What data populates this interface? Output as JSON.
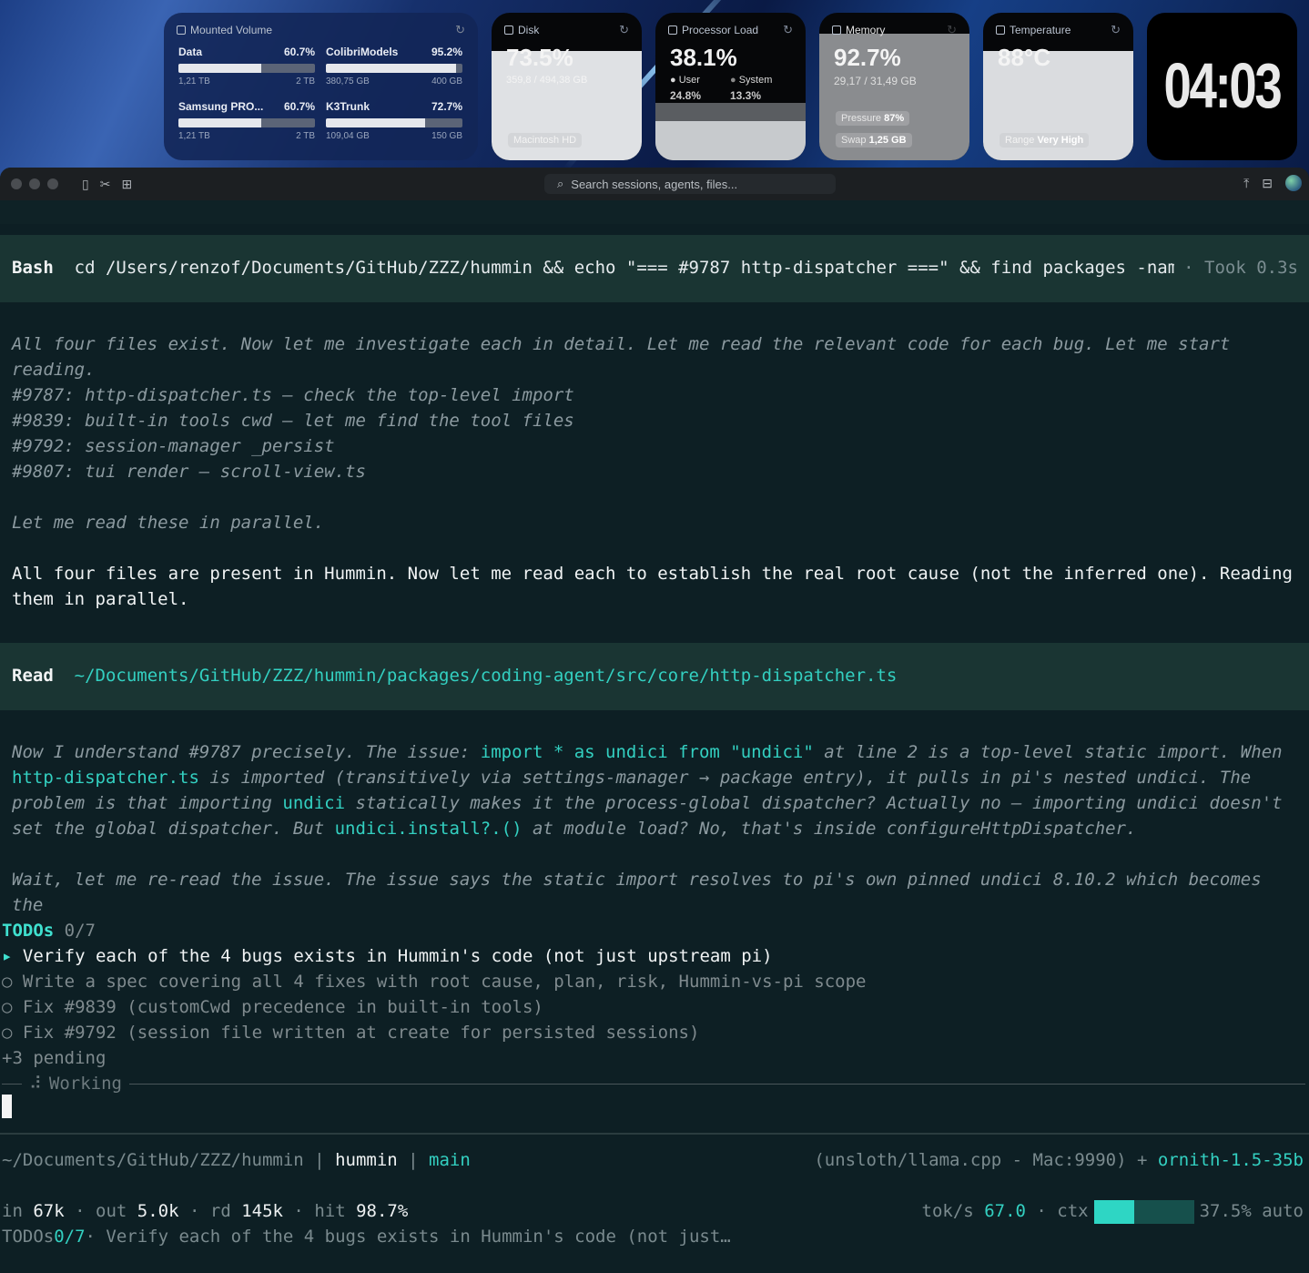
{
  "desktop": {
    "volumes": {
      "title": "Mounted Volume",
      "items": [
        {
          "name": "Data",
          "percent": "60.7%",
          "fill": 0.607,
          "used": "1,21 TB",
          "total": "2 TB"
        },
        {
          "name": "ColibriModels",
          "percent": "95.2%",
          "fill": 0.952,
          "used": "380,75 GB",
          "total": "400 GB"
        },
        {
          "name": "Samsung PRO...",
          "percent": "60.7%",
          "fill": 0.607,
          "used": "1,21 TB",
          "total": "2 TB"
        },
        {
          "name": "K3Trunk",
          "percent": "72.7%",
          "fill": 0.727,
          "used": "109,04 GB",
          "total": "150 GB"
        }
      ]
    },
    "disk": {
      "title": "Disk",
      "value": "73.5%",
      "detail": "359,8 / 494,38 GB",
      "volume": "Macintosh HD",
      "fill": 0.735
    },
    "cpu": {
      "title": "Processor Load",
      "value": "38.1%",
      "user_label": "User",
      "user_value": "24.8%",
      "system_label": "System",
      "system_value": "13.3%",
      "fill": 0.381
    },
    "memory": {
      "title": "Memory",
      "value": "92.7%",
      "detail": "29,17 / 31,49 GB",
      "pressure_label": "Pressure",
      "pressure_value": "87%",
      "swap_label": "Swap",
      "swap_value": "1,25 GB",
      "fill": 0.927
    },
    "temperature": {
      "title": "Temperature",
      "value": "88°C",
      "range_label": "Range",
      "range_value": "Very High",
      "fill": 0.9
    },
    "clock": {
      "time": "04:03"
    }
  },
  "window": {
    "search_placeholder": "Search sessions, agents, files..."
  },
  "terminal": {
    "bash": {
      "label": "Bash",
      "command": "cd /Users/renzof/Documents/GitHub/ZZZ/hummin && echo \"=== #9787 http-dispatcher ===\" && find packages -name …",
      "took": "· Took 0.3s"
    },
    "thinking1": {
      "line1": "All four files exist. Now let me investigate each in detail. Let me read the relevant code for each bug. Let me start reading.",
      "items": [
        "#9787: http-dispatcher.ts — check the top-level import",
        "#9839: built-in tools cwd — let me find the tool files",
        "#9792: session-manager _persist",
        "#9807: tui render — scroll-view.ts"
      ],
      "line2": "Let me read these in parallel."
    },
    "reply1": "All four files are present in Hummin. Now let me read each to establish the real root cause (not the inferred one). Reading them in parallel.",
    "read": {
      "label": "Read",
      "path": "~/Documents/GitHub/ZZZ/hummin/packages/coding-agent/src/core/http-dispatcher.ts"
    },
    "thinking2": {
      "p1_a": "Now I understand #9787 precisely. The issue: ",
      "p1_code1": "import * as undici from \"undici\"",
      "p1_b": " at line 2 is a top-level static import. When ",
      "p1_code2": "http-dispatcher.ts",
      "p1_c": " is imported (transitively via settings-manager → package entry), it pulls in pi's nested undici. The problem is that importing ",
      "p1_code3": "undici",
      "p1_d": " statically makes it the process-global dispatcher? Actually no — importing undici doesn't set the global dispatcher. But ",
      "p1_code4": "undici.install?.()",
      "p1_e": " at module load? No, that's inside configureHttpDispatcher.",
      "p2": "Wait, let me re-read the issue. The issue says the static import resolves to pi's own pinned undici 8.10.2 which becomes the"
    },
    "todos": {
      "label": "TODOs",
      "count": "0/7",
      "active": "Verify each of the 4 bugs exists in Hummin's code (not just upstream pi)",
      "pending": [
        "Write a spec covering all 4 fixes with root cause, plan, risk, Hummin-vs-pi scope",
        "Fix #9839 (customCwd precedence in built-in tools)",
        "Fix #9792 (session file written at create for persisted sessions)"
      ],
      "more": "+3 pending"
    },
    "working": "Working"
  },
  "statusbar": {
    "path": "~/Documents/GitHub/ZZZ/hummin",
    "project": "hummin",
    "branch": "main",
    "provider": "(unsloth/llama.cpp - Mac:9990) +",
    "model": "ornith-1.5-35b",
    "in_label": "in",
    "in_value": "67k",
    "out_label": "out",
    "out_value": "5.0k",
    "rd_label": "rd",
    "rd_value": "145k",
    "hit_label": "hit",
    "hit_value": "98.7%",
    "toks_label": "tok/s",
    "toks_value": "67.0",
    "ctx_label": "ctx",
    "ctx_fill": 0.375,
    "ctx_value": "37.5% auto",
    "todo_label": "TODOs",
    "todo_count": "0/7",
    "todo_text": "· Verify each of the 4 bugs exists in Hummin's code (not just…"
  }
}
